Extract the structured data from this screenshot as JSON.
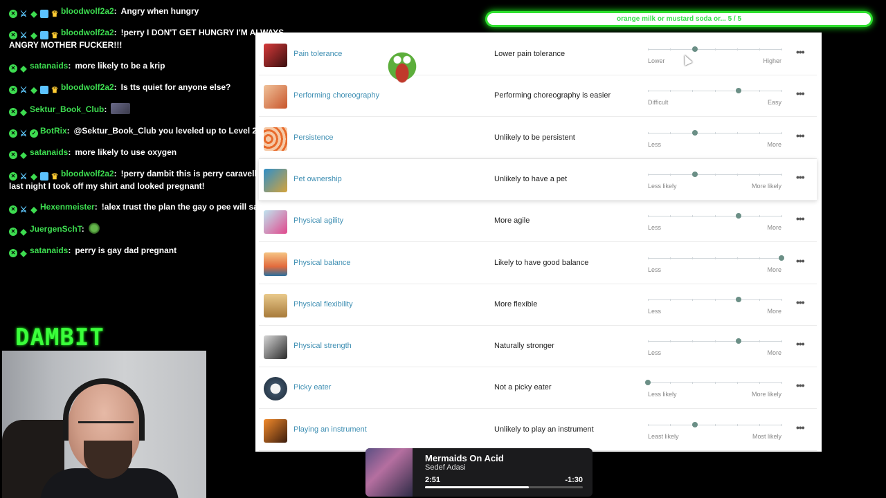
{
  "chat": [
    {
      "badges": [
        "x",
        "sword",
        "diamond",
        "box",
        "crown"
      ],
      "user": "bloodwolf2a2",
      "message": "Angry when hungry",
      "emote": false
    },
    {
      "badges": [
        "x",
        "sword",
        "diamond",
        "box",
        "crown"
      ],
      "user": "bloodwolf2a2",
      "message": "!perry I DON'T GET HUNGRY I'M ALWAYS ANGRY MOTHER FUCKER!!!",
      "emote": false
    },
    {
      "badges": [
        "x",
        "diamond"
      ],
      "user": "satanaids",
      "message": "more likely to be a krip",
      "emote": false
    },
    {
      "badges": [
        "x",
        "sword",
        "diamond",
        "box",
        "crown"
      ],
      "user": "bloodwolf2a2",
      "message": "Is tts quiet for anyone else?",
      "emote": false
    },
    {
      "badges": [
        "x",
        "diamond"
      ],
      "user": "Sektur_Book_Club",
      "message": "",
      "emote": "large"
    },
    {
      "badges": [
        "x",
        "sword",
        "check"
      ],
      "user": "BotRix",
      "message": "@Sektur_Book_Club you leveled up to Level 2",
      "emote": false
    },
    {
      "badges": [
        "x",
        "diamond"
      ],
      "user": "satanaids",
      "message": "more likely to use oxygen",
      "emote": false
    },
    {
      "badges": [
        "x",
        "sword",
        "diamond",
        "box",
        "crown"
      ],
      "user": "bloodwolf2a2",
      "message": "!perry dambit this is perry caravello on stream last night I took off my shirt and looked pregnant!",
      "emote": false
    },
    {
      "badges": [
        "x",
        "sword",
        "diamond"
      ],
      "user": "Hexenmeister",
      "message": "!alex trust the plan the gay o pee will save us",
      "emote": false
    },
    {
      "badges": [
        "x",
        "diamond"
      ],
      "user": "JuergenSchT",
      "message": "",
      "emote": "small"
    },
    {
      "badges": [
        "x",
        "diamond"
      ],
      "user": "satanaids",
      "message": "perry is gay dad pregnant",
      "emote": false
    }
  ],
  "overlay": {
    "brand": "DAMBIT"
  },
  "poll": {
    "text": "orange milk or mustard soda or... 5 / 5"
  },
  "traits": [
    {
      "name": "Pain tolerance",
      "desc": "Lower pain tolerance",
      "left": "Lower",
      "right": "Higher",
      "value": 0.35,
      "thumb": "t0"
    },
    {
      "name": "Performing choreography",
      "desc": "Performing choreography is easier",
      "left": "Difficult",
      "right": "Easy",
      "value": 0.68,
      "thumb": "t1"
    },
    {
      "name": "Persistence",
      "desc": "Unlikely to be persistent",
      "left": "Less",
      "right": "More",
      "value": 0.35,
      "thumb": "t2"
    },
    {
      "name": "Pet ownership",
      "desc": "Unlikely to have a pet",
      "left": "Less likely",
      "right": "More likely",
      "value": 0.35,
      "thumb": "t3"
    },
    {
      "name": "Physical agility",
      "desc": "More agile",
      "left": "Less",
      "right": "More",
      "value": 0.68,
      "thumb": "t4"
    },
    {
      "name": "Physical balance",
      "desc": "Likely to have good balance",
      "left": "Less",
      "right": "More",
      "value": 1.0,
      "thumb": "t5"
    },
    {
      "name": "Physical flexibility",
      "desc": "More flexible",
      "left": "Less",
      "right": "More",
      "value": 0.68,
      "thumb": "t6"
    },
    {
      "name": "Physical strength",
      "desc": "Naturally stronger",
      "left": "Less",
      "right": "More",
      "value": 0.68,
      "thumb": "t7"
    },
    {
      "name": "Picky eater",
      "desc": "Not a picky eater",
      "left": "Less likely",
      "right": "More likely",
      "value": 0.0,
      "thumb": "t8"
    },
    {
      "name": "Playing an instrument",
      "desc": "Unlikely to play an instrument",
      "left": "Least likely",
      "right": "Most likely",
      "value": 0.35,
      "thumb": "t9"
    }
  ],
  "player": {
    "title": "Mermaids On Acid",
    "artist": "Sedef Adasi",
    "elapsed": "2:51",
    "remaining": "-1:30",
    "progress": 0.66
  }
}
